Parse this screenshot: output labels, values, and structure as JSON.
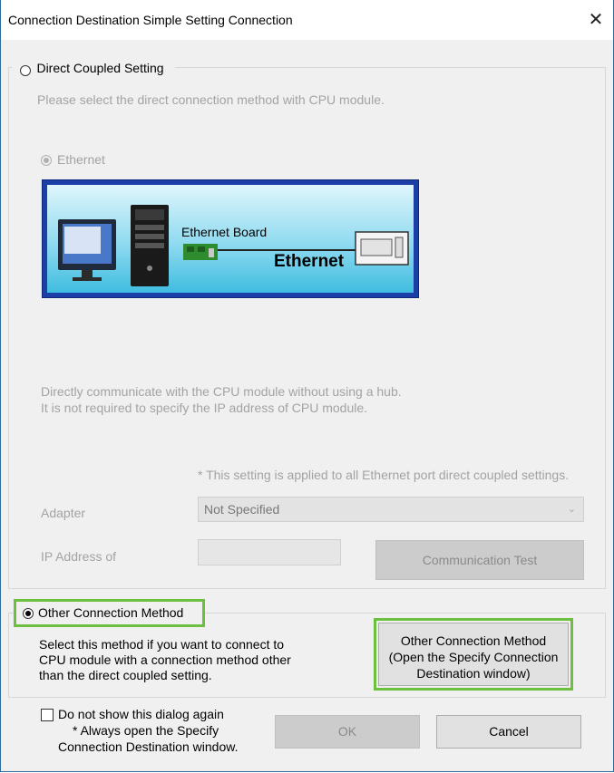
{
  "window": {
    "title": "Connection Destination Simple Setting Connection",
    "close_symbol": "✕"
  },
  "direct": {
    "radio_label": "Direct Coupled Setting",
    "description": "Please select the direct connection method with CPU module.",
    "ethernet_label": "Ethernet",
    "diagram": {
      "board_label": "Ethernet Board",
      "link_label": "Ethernet"
    },
    "explanation_line1": "Directly communicate with the CPU module without using a hub.",
    "explanation_line2": "It is not required to specify the IP address of CPU module.",
    "note": "* This setting is applied to all Ethernet port direct coupled settings.",
    "adapter_label": "Adapter",
    "adapter_value": "Not Specified",
    "ip_label": "IP Address of",
    "ip_value": "",
    "comm_test_button": "Communication Test"
  },
  "other": {
    "radio_label": "Other Connection Method",
    "description_line1": "Select this method if you want to connect to",
    "description_line2": "CPU module with a connection method other",
    "description_line3": "than the direct coupled setting.",
    "button_line1": "Other Connection Method",
    "button_line2": "(Open the Specify Connection",
    "button_line3": "Destination window)"
  },
  "footer": {
    "checkbox_label": "Do not show this dialog again",
    "note_line1": "* Always open the Specify",
    "note_line2": "Connection Destination window.",
    "ok_button": "OK",
    "cancel_button": "Cancel"
  },
  "colors": {
    "highlight": "#6cbf3f",
    "diagram_border": "#1b3fa6",
    "disabled_text": "#a3a3a3"
  }
}
